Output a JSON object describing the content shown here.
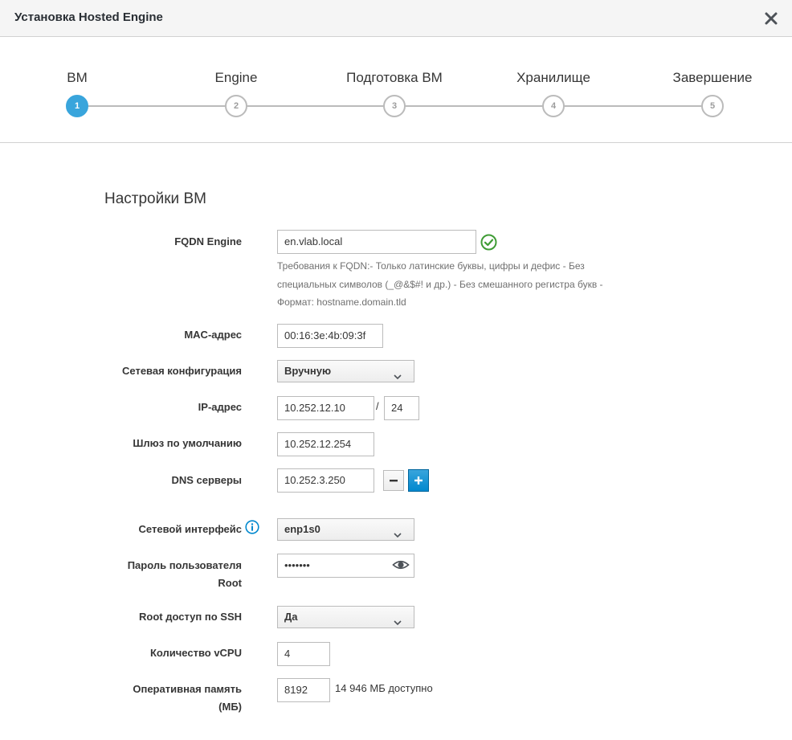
{
  "dialog": {
    "title": "Установка Hosted Engine"
  },
  "wizard": {
    "steps": [
      {
        "number": "1",
        "label": "ВМ"
      },
      {
        "number": "2",
        "label": "Engine"
      },
      {
        "number": "3",
        "label": "Подготовка ВМ"
      },
      {
        "number": "4",
        "label": "Хранилище"
      },
      {
        "number": "5",
        "label": "Завершение"
      }
    ]
  },
  "section": {
    "title": "Настройки ВМ"
  },
  "form": {
    "fqdn": {
      "label": "FQDN Engine",
      "value": "en.vlab.local",
      "help": "Требования к FQDN:- Только латинские буквы, цифры и дефис - Без специальных символов (_@&$#! и др.) - Без смешанного регистра букв - Формат: hostname.domain.tld"
    },
    "mac": {
      "label": "MAC-адрес",
      "value": "00:16:3e:4b:09:3f"
    },
    "network_config": {
      "label": "Сетевая конфигурация",
      "value": "Вручную"
    },
    "ip": {
      "label": "IP-адрес",
      "value": "10.252.12.10",
      "separator": "/",
      "prefix": "24"
    },
    "gateway": {
      "label": "Шлюз по умолчанию",
      "value": "10.252.12.254"
    },
    "dns": {
      "label": "DNS серверы",
      "value": "10.252.3.250"
    },
    "interface": {
      "label": "Сетевой интерфейс",
      "value": "enp1s0"
    },
    "root_password": {
      "label_line1": "Пароль пользователя",
      "label_line2": "Root",
      "value": "•••••••"
    },
    "ssh": {
      "label": "Root доступ по SSH",
      "value": "Да"
    },
    "vcpu": {
      "label": "Количество vCPU",
      "value": "4"
    },
    "memory": {
      "label_line1": "Оперативная память",
      "label_line2": "(МБ)",
      "value": "8192",
      "available": "14 946 МБ доступно"
    }
  },
  "colors": {
    "accent": "#39a5dc",
    "success": "#3f9c35",
    "info": "#0088ce"
  }
}
